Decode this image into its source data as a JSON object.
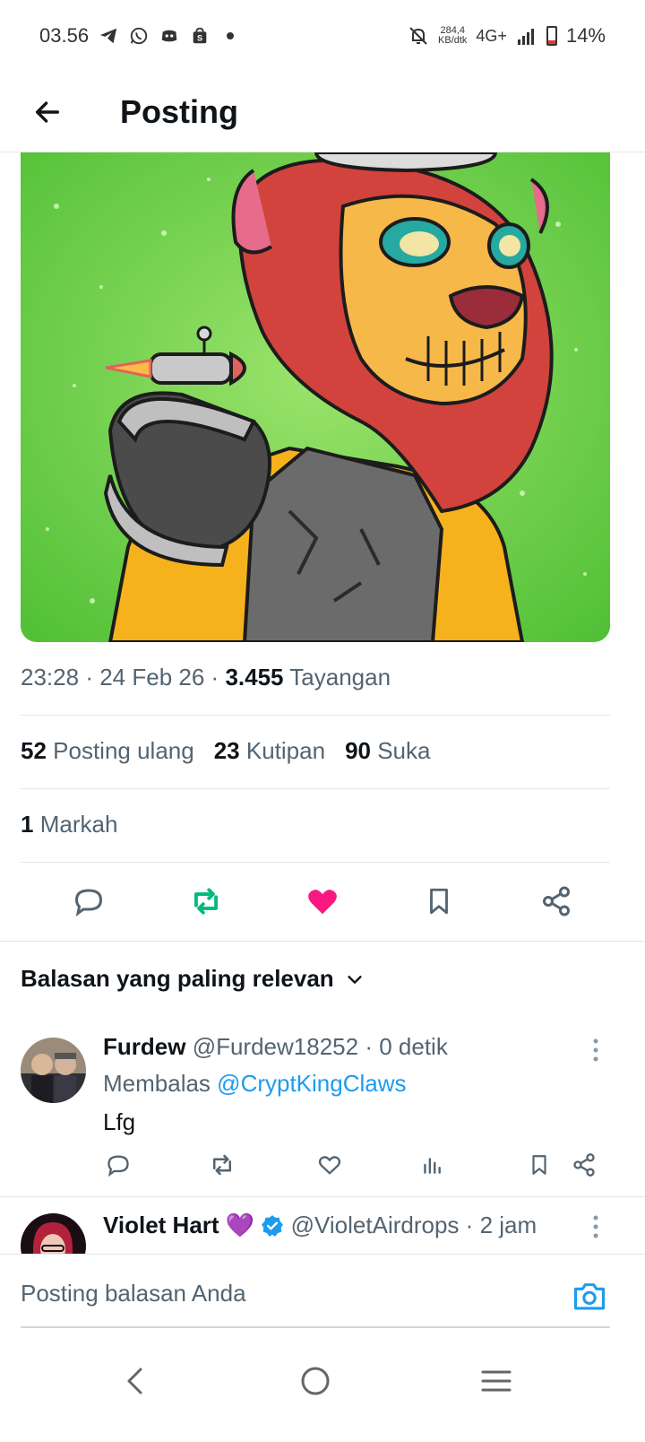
{
  "status_bar": {
    "time": "03.56",
    "net_speed_value": "284,4",
    "net_speed_unit": "KB/dtk",
    "network": "4G+",
    "battery": "14%",
    "icons": [
      "telegram-icon",
      "whatsapp-icon",
      "discord-icon",
      "shop-icon",
      "dot-icon",
      "mute-icon",
      "signal-icon",
      "battery-icon"
    ]
  },
  "header": {
    "title": "Posting"
  },
  "post": {
    "time": "23:28",
    "sep1": "·",
    "date": "24 Feb 26",
    "sep2": "·",
    "views_count": "3.455",
    "views_label": "Tayangan",
    "reposts_count": "52",
    "reposts_label": "Posting ulang",
    "quotes_count": "23",
    "quotes_label": "Kutipan",
    "likes_count": "90",
    "likes_label": "Suka",
    "bookmarks_count": "1",
    "bookmarks_label": "Markah"
  },
  "colors": {
    "accent": "#1d9bf0",
    "repost_active": "#00ba7c",
    "like_active": "#f91880"
  },
  "sort": {
    "label": "Balasan yang paling relevan"
  },
  "replies": [
    {
      "name": "Furdew",
      "handle": "@Furdew18252",
      "sep": "·",
      "time": "0 detik",
      "replying_prefix": "Membalas",
      "replying_to": "@CryptKingClaws",
      "text": "Lfg"
    },
    {
      "name": "Violet Hart",
      "emoji": "💜",
      "handle": "@VioletAirdrops",
      "sep": "·",
      "time": "2 jam"
    }
  ],
  "composer": {
    "placeholder": "Posting balasan Anda"
  }
}
